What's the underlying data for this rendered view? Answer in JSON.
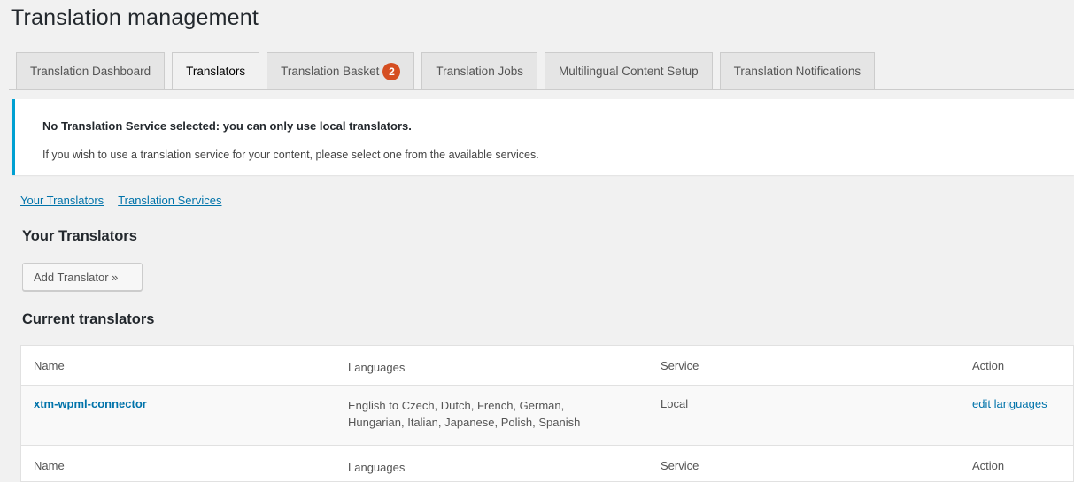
{
  "page": {
    "title": "Translation management"
  },
  "tabs": [
    {
      "label": "Translation Dashboard"
    },
    {
      "label": "Translators"
    },
    {
      "label": "Translation Basket",
      "badge": "2"
    },
    {
      "label": "Translation Jobs"
    },
    {
      "label": "Multilingual Content Setup"
    },
    {
      "label": "Translation Notifications"
    }
  ],
  "active_tab": "Translators",
  "notice": {
    "title": "No Translation Service selected: you can only use local translators.",
    "text": "If you wish to use a translation service for your content, please select one from the available services."
  },
  "sublinks": [
    "Your Translators",
    "Translation Services"
  ],
  "your_translators": {
    "heading": "Your Translators",
    "add_button": "Add Translator »"
  },
  "current_translators": {
    "heading": "Current translators",
    "columns": [
      "Name",
      "Languages",
      "Service",
      "Action"
    ],
    "rows": [
      {
        "name": "xtm-wpml-connector",
        "languages": "English to Czech, Dutch, French, German, Hungarian, Italian, Japanese, Polish, Spanish",
        "service": "Local",
        "action": "edit languages"
      }
    ]
  },
  "colors": {
    "link": "#0073aa",
    "badge": "#d54e21",
    "notice_border": "#00a0d2"
  }
}
